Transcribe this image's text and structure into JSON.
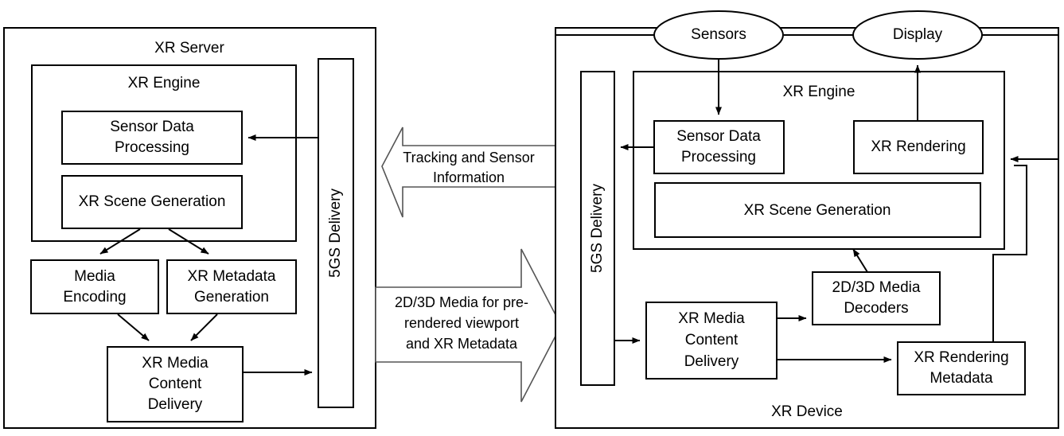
{
  "diagram": {
    "title_left": "XR Server",
    "title_right": "XR Device",
    "left_panel": {
      "label": "XR Server",
      "engine_label": "XR Engine",
      "boxes": {
        "sensor_data_processing": "Sensor Data\nProcessing",
        "sensor_data_processing_l1": "Sensor Data",
        "sensor_data_processing_l2": "Processing",
        "xr_scene_generation": "XR Scene Generation",
        "media_encoding_l1": "Media",
        "media_encoding_l2": "Encoding",
        "xr_metadata_generation_l1": "XR Metadata",
        "xr_metadata_generation_l2": "Generation",
        "xr_media_content_delivery_l1": "XR Media",
        "xr_media_content_delivery_l2": "Content",
        "xr_media_content_delivery_l3": "Delivery",
        "delivery_5gs": "5GS Delivery"
      }
    },
    "center_arrows": {
      "uplink_l1": "Tracking and Sensor",
      "uplink_l2": "Information",
      "downlink_l1": "2D/3D Media for pre-",
      "downlink_l2": "rendered viewport",
      "downlink_l3": "and XR Metadata"
    },
    "right_panel": {
      "label": "XR Device",
      "engine_label": "XR Engine",
      "ellipses": {
        "sensors": "Sensors",
        "display": "Display"
      },
      "boxes": {
        "delivery_5gs": "5GS Delivery",
        "sensor_data_processing_l1": "Sensor Data",
        "sensor_data_processing_l2": "Processing",
        "xr_rendering": "XR Rendering",
        "xr_scene_generation": "XR Scene Generation",
        "xr_media_content_delivery_l1": "XR Media",
        "xr_media_content_delivery_l2": "Content",
        "xr_media_content_delivery_l3": "Delivery",
        "media_decoders_l1": "2D/3D Media",
        "media_decoders_l2": "Decoders",
        "xr_rendering_metadata_l1": "XR Rendering",
        "xr_rendering_metadata_l2": "Metadata"
      }
    },
    "colors": {
      "stroke": "#000000",
      "fill": "#ffffff",
      "arrow_stroke": "#555555"
    }
  }
}
